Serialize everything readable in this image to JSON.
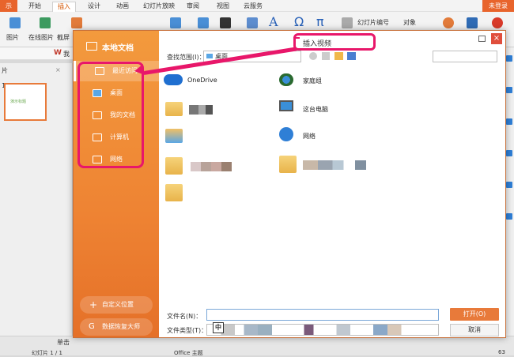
{
  "ribbon": {
    "app_label": "示",
    "tabs": [
      "开始",
      "插入",
      "设计",
      "动画",
      "幻灯片放映",
      "审阅",
      "视图",
      "云服务"
    ],
    "active_tab": "插入",
    "login": "未登录",
    "tools_row": [
      "图片",
      "在线图片",
      "截屏"
    ],
    "right_tools": [
      "幻灯片编号",
      "对象"
    ],
    "pin_label": "我"
  },
  "left_pane": {
    "header": "片",
    "slide_number": "1",
    "thumb_text": "演示标题"
  },
  "status": {
    "slide_info": "幻灯片 1 / 1",
    "theme": "Office 主题",
    "notes_hint": "单击",
    "zoom": "63"
  },
  "dialog": {
    "title": "插入视频",
    "brand": "本地文档",
    "nav": [
      {
        "label": "最近访问"
      },
      {
        "label": "桌面"
      },
      {
        "label": "我的文档"
      },
      {
        "label": "计算机"
      },
      {
        "label": "网络"
      }
    ],
    "custom_location": "自定义位置",
    "recovery": "数据恢复大师",
    "lookin_label": "查找范围(I)：",
    "lookin_value": "桌面",
    "files": [
      {
        "name": "OneDrive",
        "icon": "cloud-icon"
      },
      {
        "name": "家庭组",
        "icon": "homegroup-icon"
      },
      {
        "name": "",
        "icon": "user-folder-icon"
      },
      {
        "name": "这台电脑",
        "icon": "computer-icon"
      },
      {
        "name": "",
        "icon": "library-folder-icon"
      },
      {
        "name": "网络",
        "icon": "network-icon"
      },
      {
        "name": "",
        "icon": "folder-icon"
      },
      {
        "name": "",
        "icon": "folder-icon"
      },
      {
        "name": "",
        "icon": "folder-icon"
      }
    ],
    "filename_label": "文件名(N)：",
    "filename_value": "",
    "filetype_label": "文件类型(T)：",
    "ime_indicator": "中",
    "open_button": "打开(O)",
    "cancel_button": "取消",
    "colors": {
      "accent": "#ee8333",
      "highlight": "#e8176a"
    }
  }
}
